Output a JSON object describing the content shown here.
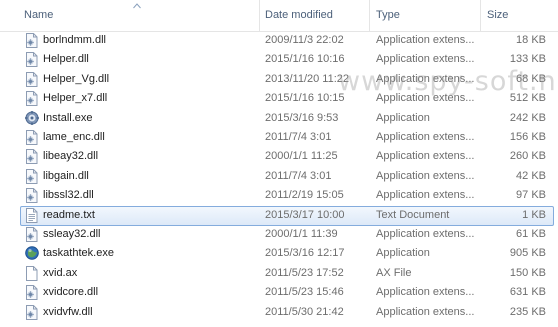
{
  "columns": {
    "name": "Name",
    "date": "Date modified",
    "type": "Type",
    "size": "Size"
  },
  "watermark": "www.spy-soft.net",
  "files": [
    {
      "name": "borlndmm.dll",
      "date": "2009/11/3 22:02",
      "type": "Application extens...",
      "size": "18 KB",
      "icon": "dll-icon"
    },
    {
      "name": "Helper.dll",
      "date": "2015/1/16 10:16",
      "type": "Application extens...",
      "size": "133 KB",
      "icon": "dll-icon"
    },
    {
      "name": "Helper_Vg.dll",
      "date": "2013/11/20 11:22",
      "type": "Application extens...",
      "size": "68 KB",
      "icon": "dll-icon"
    },
    {
      "name": "Helper_x7.dll",
      "date": "2015/1/16 10:15",
      "type": "Application extens...",
      "size": "512 KB",
      "icon": "dll-icon"
    },
    {
      "name": "Install.exe",
      "date": "2015/3/16 9:53",
      "type": "Application",
      "size": "242 KB",
      "icon": "gear-exe-icon"
    },
    {
      "name": "lame_enc.dll",
      "date": "2011/7/4 3:01",
      "type": "Application extens...",
      "size": "156 KB",
      "icon": "dll-icon"
    },
    {
      "name": "libeay32.dll",
      "date": "2000/1/1 11:25",
      "type": "Application extens...",
      "size": "260 KB",
      "icon": "dll-icon"
    },
    {
      "name": "libgain.dll",
      "date": "2011/7/4 3:01",
      "type": "Application extens...",
      "size": "42 KB",
      "icon": "dll-icon"
    },
    {
      "name": "libssl32.dll",
      "date": "2011/2/19 15:05",
      "type": "Application extens...",
      "size": "97 KB",
      "icon": "dll-icon"
    },
    {
      "name": "readme.txt",
      "date": "2015/3/17 10:00",
      "type": "Text Document",
      "size": "1 KB",
      "icon": "text-file-icon"
    },
    {
      "name": "ssleay32.dll",
      "date": "2000/1/1 11:39",
      "type": "Application extens...",
      "size": "61 KB",
      "icon": "dll-icon"
    },
    {
      "name": "taskathtek.exe",
      "date": "2015/3/16 12:17",
      "type": "Application",
      "size": "905 KB",
      "icon": "globe-exe-icon"
    },
    {
      "name": "xvid.ax",
      "date": "2011/5/23 17:52",
      "type": "AX File",
      "size": "150 KB",
      "icon": "blank-file-icon"
    },
    {
      "name": "xvidcore.dll",
      "date": "2011/5/23 15:46",
      "type": "Application extens...",
      "size": "631 KB",
      "icon": "dll-icon"
    },
    {
      "name": "xvidvfw.dll",
      "date": "2011/5/30 21:42",
      "type": "Application extens...",
      "size": "235 KB",
      "icon": "dll-icon"
    }
  ],
  "selected_index": 9
}
